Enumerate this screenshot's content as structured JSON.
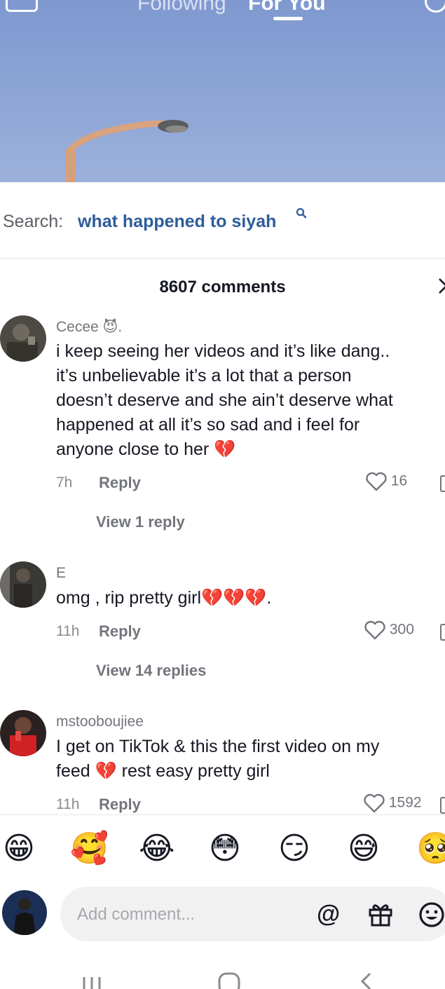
{
  "top_nav": {
    "following_label": "Following",
    "foryou_label": "For You"
  },
  "search": {
    "prefix": "Search:",
    "query": "what happened to siyah",
    "query_icon": "search-icon"
  },
  "comments_header": {
    "count_label": "8607 comments",
    "close_icon": "close-icon"
  },
  "comments": [
    {
      "username": "Cecee 😈.",
      "text": "i keep seeing her videos and it’s like dang..\nit’s unbelievable it’s a lot that a person\ndoesn’t deserve and she ain’t deserve what\nhappened at all it’s so sad and i feel for\nanyone close to her 💔",
      "time": "7h",
      "reply_label": "Reply",
      "likes": "16",
      "view_replies": "View 1 reply"
    },
    {
      "username": "E",
      "text": "omg , rip pretty girl💔💔💔.",
      "time": "11h",
      "reply_label": "Reply",
      "likes": "300",
      "view_replies": "View 14 replies"
    },
    {
      "username": "mstooboujiee",
      "text": "I get on TikTok & this the first video on my\nfeed 💔 rest easy pretty girl",
      "time": "11h",
      "reply_label": "Reply",
      "likes": "1592"
    }
  ],
  "emoji_bar": [
    "😁",
    "🥰",
    "😂",
    "😳",
    "😏",
    "😅",
    "🥺"
  ],
  "comment_input": {
    "placeholder": "Add comment...",
    "mention_icon": "@",
    "gift_icon": "gift-icon",
    "emoji_icon": "emoji-icon"
  },
  "system_nav": {
    "recents_icon": "recents-icon",
    "home_icon": "home-icon",
    "back_icon": "back-icon"
  },
  "colors": {
    "accent_link": "#2e5c9a",
    "text_primary": "#161823",
    "text_secondary": "#73757c",
    "sky": "#8ea5d6"
  }
}
